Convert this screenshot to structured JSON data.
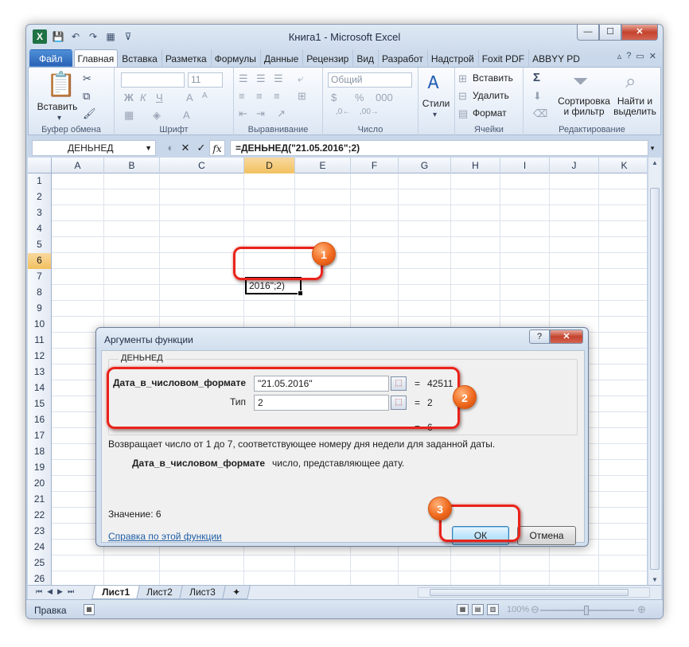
{
  "window": {
    "title": "Книга1 - Microsoft Excel",
    "controls": {
      "minimize": "—",
      "maximize": "☐",
      "close": "✕"
    }
  },
  "qat": {
    "logo": "X",
    "save": "💾",
    "undo": "↶",
    "redo": "↷",
    "extra": "▦",
    "more": "⊽"
  },
  "tabs": [
    "Файл",
    "Главная",
    "Вставка",
    "Разметка",
    "Формулы",
    "Данные",
    "Рецензир",
    "Вид",
    "Разработ",
    "Надстрой",
    "Foxit PDF",
    "ABBYY PD"
  ],
  "ribbon": {
    "clipboard": {
      "paste_label": "Вставить",
      "group_label": "Буфер обмена"
    },
    "font": {
      "font_size": "11",
      "group_label": "Шрифт"
    },
    "alignment": {
      "group_label": "Выравнивание"
    },
    "number": {
      "format": "Общий",
      "group_label": "Число"
    },
    "styles": {
      "label": "Стили"
    },
    "cells": {
      "insert": "Вставить",
      "delete": "Удалить",
      "format": "Формат",
      "group_label": "Ячейки"
    },
    "editing": {
      "sum": "Σ",
      "sort_label": "Сортировка\nи фильтр",
      "find_label": "Найти и\nвыделить",
      "group_label": "Редактирование"
    }
  },
  "formula_bar": {
    "name_box": "ДЕНЬНЕД",
    "cancel": "✕",
    "enter": "✓",
    "fx": "fx",
    "formula": "=ДЕНЬНЕД(\"21.05.2016\";2)"
  },
  "grid": {
    "columns": [
      "A",
      "B",
      "C",
      "D",
      "E",
      "F",
      "G",
      "H",
      "I",
      "J",
      "K"
    ],
    "selected_column": "D",
    "rows": [
      "1",
      "2",
      "3",
      "4",
      "5",
      "6",
      "7",
      "8",
      "9",
      "10",
      "11",
      "12",
      "13",
      "14",
      "15",
      "16",
      "17",
      "18",
      "19",
      "20",
      "21",
      "22",
      "23",
      "24",
      "25",
      "26"
    ],
    "selected_row": "6",
    "active_cell_text": "2016\";2)"
  },
  "sheets": [
    "Лист1",
    "Лист2",
    "Лист3"
  ],
  "status": {
    "text": "Правка",
    "zoom": "100%"
  },
  "dialog": {
    "title": "Аргументы функции",
    "help": "?",
    "close": "✕",
    "function_name": "ДЕНЬНЕД",
    "args": [
      {
        "name": "Дата_в_числовом_формате",
        "value": "\"21.05.2016\"",
        "result": "42511"
      },
      {
        "name": "Тип",
        "value": "2",
        "result": "2"
      }
    ],
    "eq": "=",
    "overall_result": "6",
    "description": "Возвращает число от 1 до 7, соответствующее номеру дня недели для заданной даты.",
    "arg_desc_name": "Дата_в_числовом_формате",
    "arg_desc_text": "число, представляющее дату.",
    "value_label": "Значение:  6",
    "help_link": "Справка по этой функции",
    "ok": "ОК",
    "cancel": "Отмена"
  },
  "annotations": [
    "1",
    "2",
    "3"
  ],
  "colors": {
    "highlight": "#e8231b",
    "badge": "#f06a1e",
    "file_tab": "#2a62b5"
  }
}
